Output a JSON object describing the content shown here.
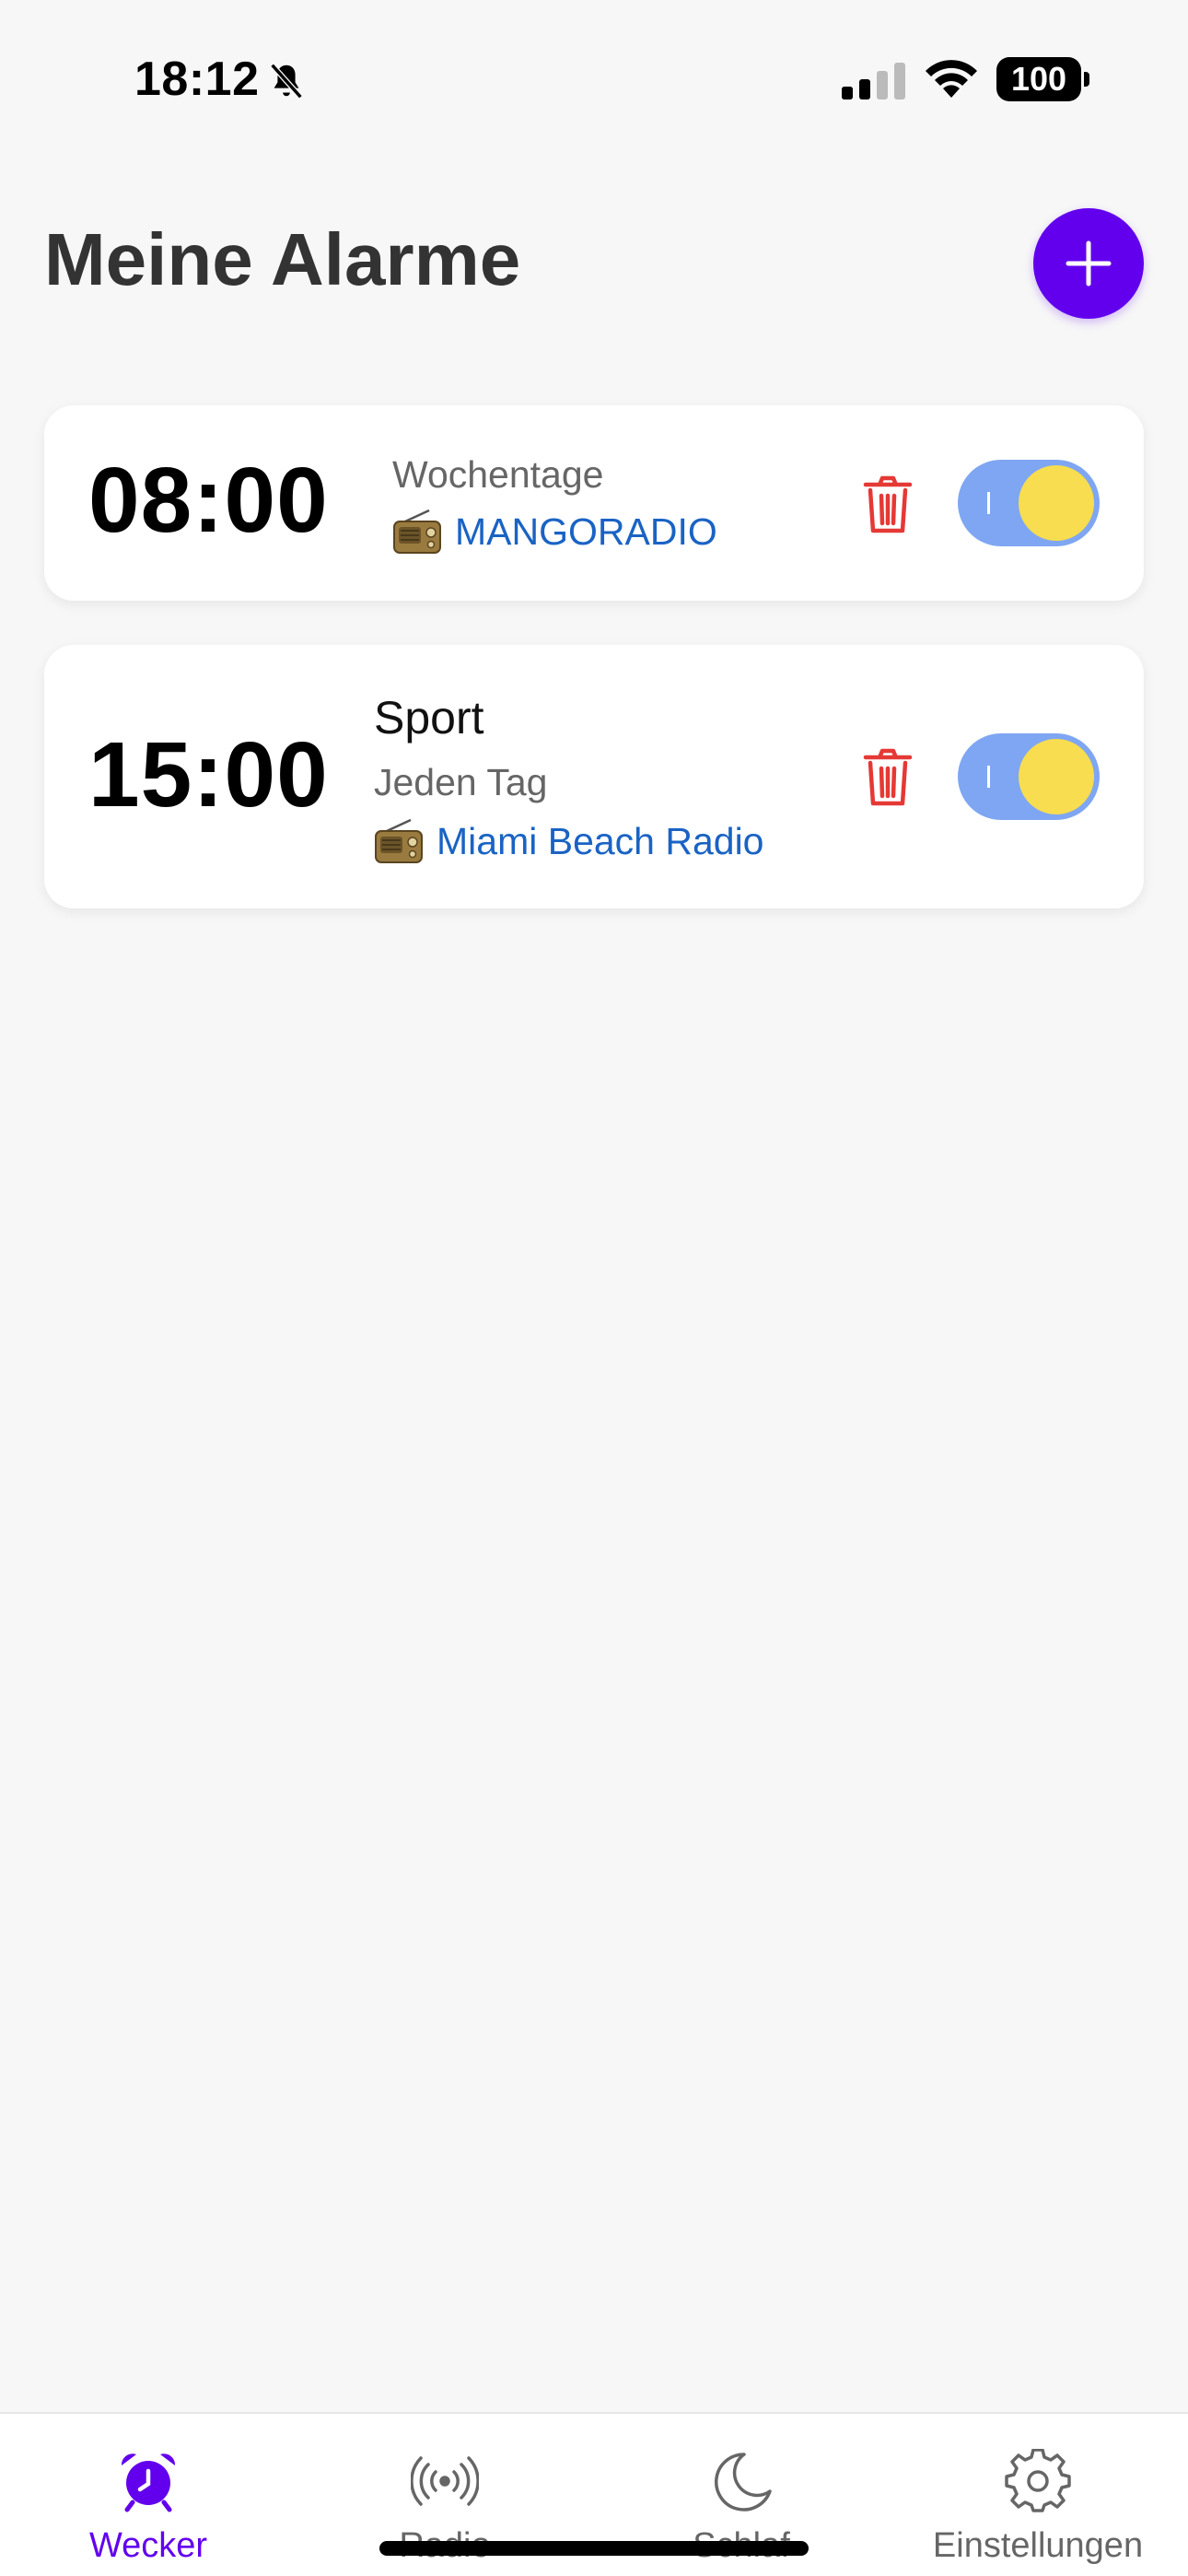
{
  "status_bar": {
    "time": "18:12",
    "battery": "100",
    "icons": [
      "bell-slash-icon",
      "signal-icon",
      "wifi-icon",
      "battery-icon"
    ]
  },
  "header": {
    "title": "Meine Alarme",
    "add_icon": "plus-icon"
  },
  "alarms": [
    {
      "time": "08:00",
      "name": "",
      "days": "Wochentage",
      "station": "MANGORADIO",
      "enabled": true
    },
    {
      "time": "15:00",
      "name": "Sport",
      "days": "Jeden Tag",
      "station": "Miami Beach Radio",
      "enabled": true
    }
  ],
  "tabs": [
    {
      "label": "Wecker",
      "icon": "alarm-clock-icon",
      "active": true
    },
    {
      "label": "Radio",
      "icon": "broadcast-icon",
      "active": false
    },
    {
      "label": "Schlaf",
      "icon": "moon-icon",
      "active": false
    },
    {
      "label": "Einstellungen",
      "icon": "gear-icon",
      "active": false
    }
  ],
  "colors": {
    "accent": "#6200ee",
    "background": "#f7f7f7",
    "delete": "#e53935",
    "station_link": "#1a63c4",
    "toggle_track": "#7fa6f2",
    "toggle_knob": "#f7dd4f"
  }
}
